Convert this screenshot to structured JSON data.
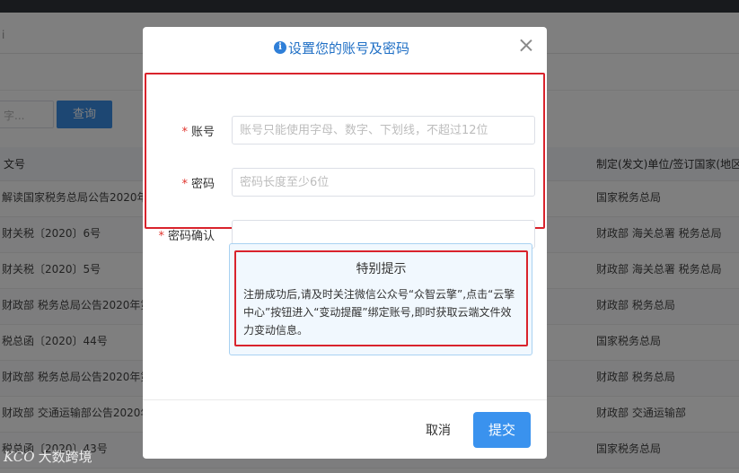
{
  "background": {
    "search_placeholder": "字...",
    "search_button": "查询",
    "columns": {
      "doc_number": "文号",
      "issuer": "制定(发文)单位/签订国家(地区)"
    },
    "rows": [
      {
        "doc_number": "解读国家税务总局公告2020年",
        "issuer": "国家税务总局"
      },
      {
        "doc_number": "财关税〔2020〕6号",
        "issuer": "财政部 海关总署 税务总局"
      },
      {
        "doc_number": "财关税〔2020〕5号",
        "issuer": "财政部 海关总署 税务总局"
      },
      {
        "doc_number": "财政部 税务总局公告2020年第",
        "issuer": "财政部 税务总局"
      },
      {
        "doc_number": "税总函〔2020〕44号",
        "issuer": "国家税务总局"
      },
      {
        "doc_number": "财政部 税务总局公告2020年第",
        "issuer": "财政部 税务总局"
      },
      {
        "doc_number": "财政部 交通运输部公告2020年",
        "issuer": "财政部 交通运输部"
      },
      {
        "doc_number": "税总函〔2020〕43号",
        "issuer": "国家税务总局"
      }
    ]
  },
  "modal": {
    "icon": "info-icon",
    "title": "设置您的账号及密码",
    "fields": {
      "account": {
        "label": "账号",
        "placeholder": "账号只能使用字母、数字、下划线，不超过12位",
        "value": ""
      },
      "password": {
        "label": "密码",
        "placeholder": "密码长度至少6位",
        "value": ""
      },
      "confirm": {
        "label": "密码确认",
        "placeholder": "",
        "value": ""
      }
    },
    "tip": {
      "title": "特别提示",
      "text": "注册成功后,请及时关注微信公众号“众智云擎”,点击“云擎中心”按钮进入“变动提醒”绑定账号,即时获取云端文件效力变动信息。"
    },
    "cancel_label": "取消",
    "submit_label": "提交"
  },
  "watermark": {
    "logo": "KCO",
    "text": "大数跨境"
  },
  "colors": {
    "primary": "#3a92ee",
    "highlight_border": "#d9232c",
    "required": "#e0342d"
  }
}
